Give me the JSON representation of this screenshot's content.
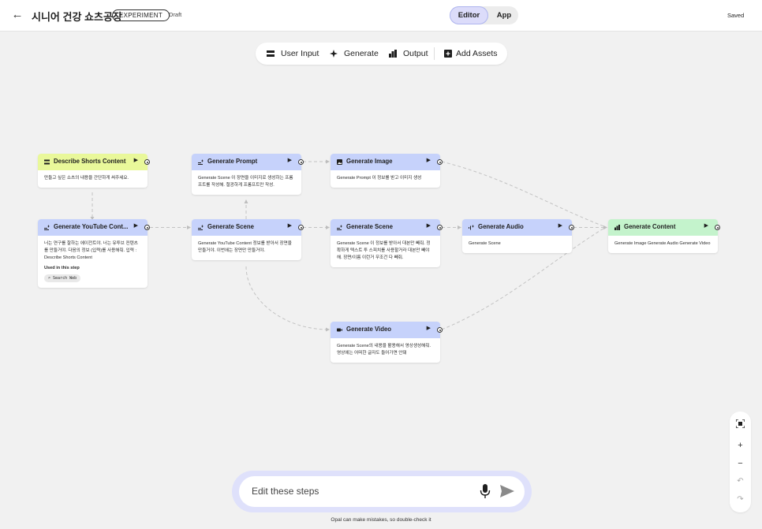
{
  "header": {
    "back_icon": "arrow-left-icon",
    "title": "시니어 건강 쇼츠공장",
    "badge": "EXPERIMENT",
    "status": "Draft",
    "mode_editor": "Editor",
    "mode_app": "App",
    "save_status": "Saved"
  },
  "toolbar": {
    "user_input": "User Input",
    "generate": "Generate",
    "output": "Output",
    "add_assets": "Add Assets"
  },
  "nodes": {
    "describe": {
      "title": "Describe Shorts Content",
      "body": "만들고 싶은 쇼츠의 내용을 간단하게 써주세요."
    },
    "gen_prompt": {
      "title": "Generate Prompt",
      "body": "Generate Scene 이 장면을 이미지로 생성하는 프롬프트를 작성해. 절광하게 프롬프트만 작성."
    },
    "gen_image": {
      "title": "Generate Image",
      "body": "Generate Prompt 이 정보를 받고 이미지 생성"
    },
    "gen_youtube": {
      "title": "Generate YouTube Cont...",
      "body": "너는 연구를 잘하는 에이전트야. 너는 유투브 컨텐츠를 만들거야. 다음의 정보 (입력)를 사용해줘. 입력 : Describe Shorts Content",
      "used_label": "Used in this step",
      "used_chip": "Search Web"
    },
    "gen_scene1": {
      "title": "Generate Scene",
      "body": "Generate YouTube Content 정보를 받아서 장면을 만들거야. 이번에는 장면만 만들거야."
    },
    "gen_scene2": {
      "title": "Generate Scene",
      "body": "Generate Scene 이 정보를 받아서 대본만 빼줘. 정확하게 텍스트 투 스피치를 사용할거라 대본만 빼야해. 장면/이름 이런거 무조건 다 빼줘."
    },
    "gen_audio": {
      "title": "Generate Audio",
      "body": "Generate Scene"
    },
    "gen_content": {
      "title": "Generate Content",
      "body": "Generate Image Generate Audio Generate Video"
    },
    "gen_video": {
      "title": "Generate Video",
      "body": "Generate Scene의 내용을 활용해서 영상생성해줘. 영상에는 어떠한 글자도 들어가면 안돼"
    }
  },
  "chat": {
    "placeholder": "Edit these steps",
    "disclaimer": "Opal can make mistakes, so double-check it"
  },
  "colors": {
    "generate_node": "#c6d2fb",
    "input_node": "#e9f89a",
    "output_node": "#c4f3cc",
    "editor_active": "#dcdcfa"
  }
}
